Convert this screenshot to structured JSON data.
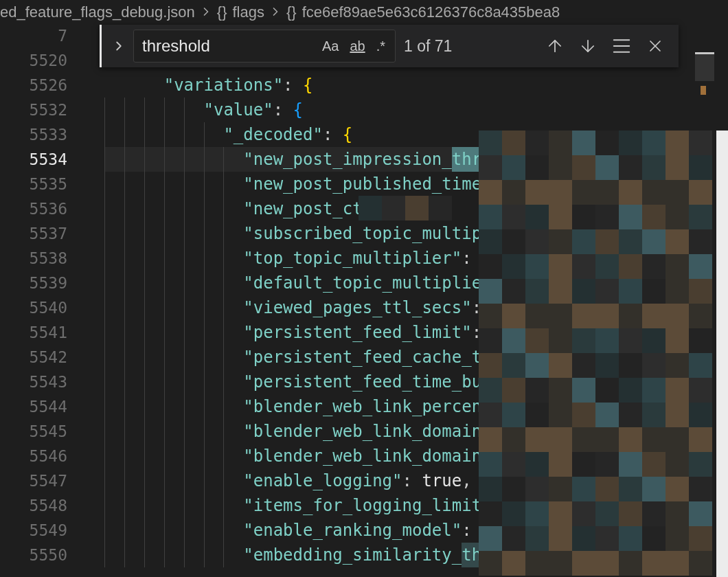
{
  "breadcrumb": [
    {
      "label": "ed_feature_flags_debug.json"
    },
    {
      "icon": "{}",
      "label": "flags"
    },
    {
      "icon": "{}",
      "label": "fce6ef89ae5e63c6126376c8a435bea8"
    }
  ],
  "find": {
    "value": "threshold",
    "options": [
      {
        "label": "Aa",
        "on": false
      },
      {
        "label": "ab",
        "on": false
      },
      {
        "label": ".*",
        "on": false
      }
    ],
    "count": "1 of 71"
  },
  "sticky_lines": [
    {
      "number": "7"
    },
    {
      "number": "5520"
    },
    {
      "number": "5526",
      "tokens": [
        {
          "kind": "key",
          "text": "\"variations\""
        },
        {
          "kind": "punct",
          "text": ": "
        },
        {
          "kind": "bracket",
          "text": "{",
          "color": "#ffd700"
        }
      ]
    }
  ],
  "lines": [
    {
      "number": "5532",
      "current": false,
      "tokens": [
        {
          "kind": "key",
          "text": "\"value\""
        },
        {
          "kind": "punct",
          "text": ": "
        },
        {
          "kind": "bracket",
          "text": "{",
          "color": "#179fff"
        }
      ],
      "children": [
        {
          "number": "5533",
          "current": false,
          "tokens": [
            {
              "kind": "key",
              "text": "\"_decoded\""
            },
            {
              "kind": "punct",
              "text": ": "
            },
            {
              "kind": "bracket",
              "text": "{",
              "color": "#ffd700"
            }
          ],
          "children": [
            {
              "number": "5534",
              "current": true,
              "tokens": [
                {
                  "kind": "key",
                  "text": "\"new_post_impression_"
                },
                {
                  "kind": "match",
                  "text": "thr",
                  "selected": true
                }
              ]
            },
            {
              "number": "5535",
              "current": false,
              "tokens": [
                {
                  "kind": "key",
                  "text": "\"new_post_published_time"
                }
              ]
            },
            {
              "number": "5536",
              "current": false,
              "tokens": [
                {
                  "kind": "key",
                  "text": "\"new_post_ct"
                }
              ]
            },
            {
              "number": "5537",
              "current": false,
              "tokens": [
                {
                  "kind": "key",
                  "text": "\"subscribed_topic_multip"
                }
              ]
            },
            {
              "number": "5538",
              "current": false,
              "tokens": [
                {
                  "kind": "key",
                  "text": "\"top_topic_multiplier\""
                },
                {
                  "kind": "punct",
                  "text": ":"
                }
              ]
            },
            {
              "number": "5539",
              "current": false,
              "tokens": [
                {
                  "kind": "key",
                  "text": "\"default_topic_multiplie"
                }
              ]
            },
            {
              "number": "5540",
              "current": false,
              "tokens": [
                {
                  "kind": "key",
                  "text": "\"viewed_pages_ttl_secs\""
                },
                {
                  "kind": "punct",
                  "text": ":"
                }
              ]
            },
            {
              "number": "5541",
              "current": false,
              "tokens": [
                {
                  "kind": "key",
                  "text": "\"persistent_feed_limit\""
                },
                {
                  "kind": "punct",
                  "text": ":"
                }
              ]
            },
            {
              "number": "5542",
              "current": false,
              "tokens": [
                {
                  "kind": "key",
                  "text": "\"persistent_feed_cache_t"
                }
              ]
            },
            {
              "number": "5543",
              "current": false,
              "tokens": [
                {
                  "kind": "key",
                  "text": "\"persistent_feed_time_bu"
                }
              ]
            },
            {
              "number": "5544",
              "current": false,
              "tokens": [
                {
                  "kind": "key",
                  "text": "\"blender_web_link_percen"
                }
              ]
            },
            {
              "number": "5545",
              "current": false,
              "tokens": [
                {
                  "kind": "key",
                  "text": "\"blender_web_link_domain"
                }
              ]
            },
            {
              "number": "5546",
              "current": false,
              "tokens": [
                {
                  "kind": "key",
                  "text": "\"blender_web_link_domain"
                }
              ]
            },
            {
              "number": "5547",
              "current": false,
              "tokens": [
                {
                  "kind": "key",
                  "text": "\"enable_logging\""
                },
                {
                  "kind": "punct",
                  "text": ": "
                },
                {
                  "kind": "literal",
                  "text": "true"
                },
                {
                  "kind": "punct",
                  "text": ","
                }
              ]
            },
            {
              "number": "5548",
              "current": false,
              "tokens": [
                {
                  "kind": "key",
                  "text": "\"items_for_logging_limit"
                }
              ]
            },
            {
              "number": "5549",
              "current": false,
              "tokens": [
                {
                  "kind": "key",
                  "text": "\"enable_ranking_model\""
                },
                {
                  "kind": "punct",
                  "text": ":"
                }
              ]
            },
            {
              "number": "5550",
              "current": false,
              "tokens": [
                {
                  "kind": "key",
                  "text": "\"embedding_similarity_"
                },
                {
                  "kind": "match",
                  "text": "th",
                  "selected": false
                }
              ]
            }
          ]
        }
      ]
    }
  ]
}
